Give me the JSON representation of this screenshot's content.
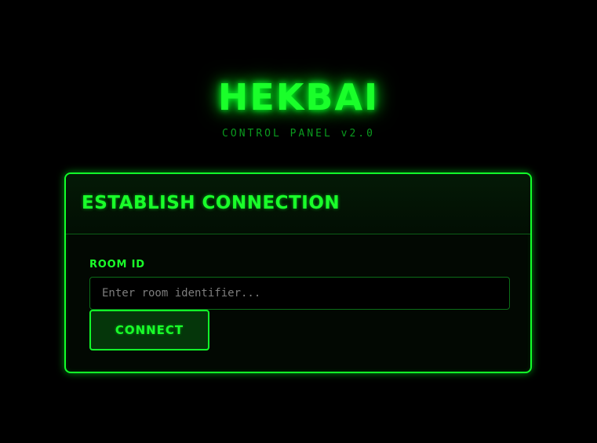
{
  "app": {
    "logo_text": "HEKBAI",
    "subtitle": "CONTROL PANEL v2.0"
  },
  "card": {
    "title": "ESTABLISH CONNECTION",
    "room_label": "ROOM ID",
    "room_input": {
      "value": "",
      "placeholder": "Enter room identifier..."
    },
    "connect_label": "CONNECT"
  },
  "colors": {
    "accent": "#1aff2a",
    "background": "#000000",
    "muted_text": "#0a9a1e",
    "button_fill": "#05360a"
  }
}
